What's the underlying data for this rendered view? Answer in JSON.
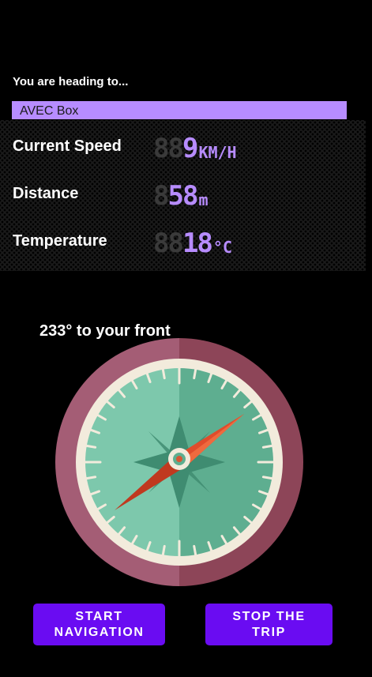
{
  "header": {
    "heading_label": "You are heading to..."
  },
  "destination": {
    "value": "AVEC Box"
  },
  "stats": [
    {
      "label": "Current Speed",
      "ghost": "88",
      "value": "9",
      "unit": "KM/H"
    },
    {
      "label": "Distance",
      "ghost": "8",
      "value": "58",
      "unit": "m"
    },
    {
      "label": "Temperature",
      "ghost": "88",
      "value": "18",
      "unit": "°C"
    }
  ],
  "compass": {
    "bearing_text": "233° to your front",
    "colors": {
      "ring_left": "#a45d75",
      "ring_right": "#8d4558",
      "inner_ring": "#f2ebdc",
      "face_left": "#7dc8ac",
      "face_right": "#5eae90",
      "needle_red": "#e04c2c",
      "needle_dark": "#c0391f"
    }
  },
  "buttons": {
    "start_label": "START\nNAVIGATION",
    "stop_label": "STOP THE\nTRIP"
  },
  "accent_color": "#b78cff",
  "button_color": "#6a0cf2"
}
